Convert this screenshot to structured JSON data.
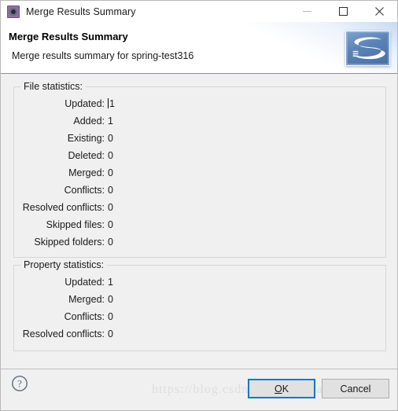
{
  "window": {
    "title": "Merge Results Summary",
    "icon": "svn-merge-icon",
    "controls": {
      "minimize": "minimize-icon",
      "maximize": "maximize-icon",
      "close": "close-icon"
    }
  },
  "header": {
    "title": "Merge Results Summary",
    "subtitle": "Merge results summary for spring-test316",
    "logo_alt": "subversive-logo",
    "logo_letter": "S"
  },
  "file_statistics": {
    "legend": "File statistics:",
    "rows": [
      {
        "label": "Updated:",
        "value": "1",
        "caret": true
      },
      {
        "label": "Added:",
        "value": "1",
        "caret": false
      },
      {
        "label": "Existing:",
        "value": "0",
        "caret": false
      },
      {
        "label": "Deleted:",
        "value": "0",
        "caret": false
      },
      {
        "label": "Merged:",
        "value": "0",
        "caret": false
      },
      {
        "label": "Conflicts:",
        "value": "0",
        "caret": false
      },
      {
        "label": "Resolved conflicts:",
        "value": "0",
        "caret": false
      },
      {
        "label": "Skipped files:",
        "value": "0",
        "caret": false
      },
      {
        "label": "Skipped folders:",
        "value": "0",
        "caret": false
      }
    ]
  },
  "property_statistics": {
    "legend": "Property statistics:",
    "rows": [
      {
        "label": "Updated:",
        "value": "1",
        "caret": false
      },
      {
        "label": "Merged:",
        "value": "0",
        "caret": false
      },
      {
        "label": "Conflicts:",
        "value": "0",
        "caret": false
      },
      {
        "label": "Resolved conflicts:",
        "value": "0",
        "caret": false
      }
    ]
  },
  "footer": {
    "help_icon": "help-question-icon",
    "ok_mnemonic": "O",
    "ok_rest": "K",
    "cancel_label": "Cancel",
    "watermark": "https://blog.csdn.net/godbrilan"
  },
  "colors": {
    "accent": "#0078d7",
    "window_bg": "#f0f0f0",
    "header_bg": "#ffffff",
    "group_border": "#d6d6d6",
    "title_icon": "#8b6fa8"
  }
}
